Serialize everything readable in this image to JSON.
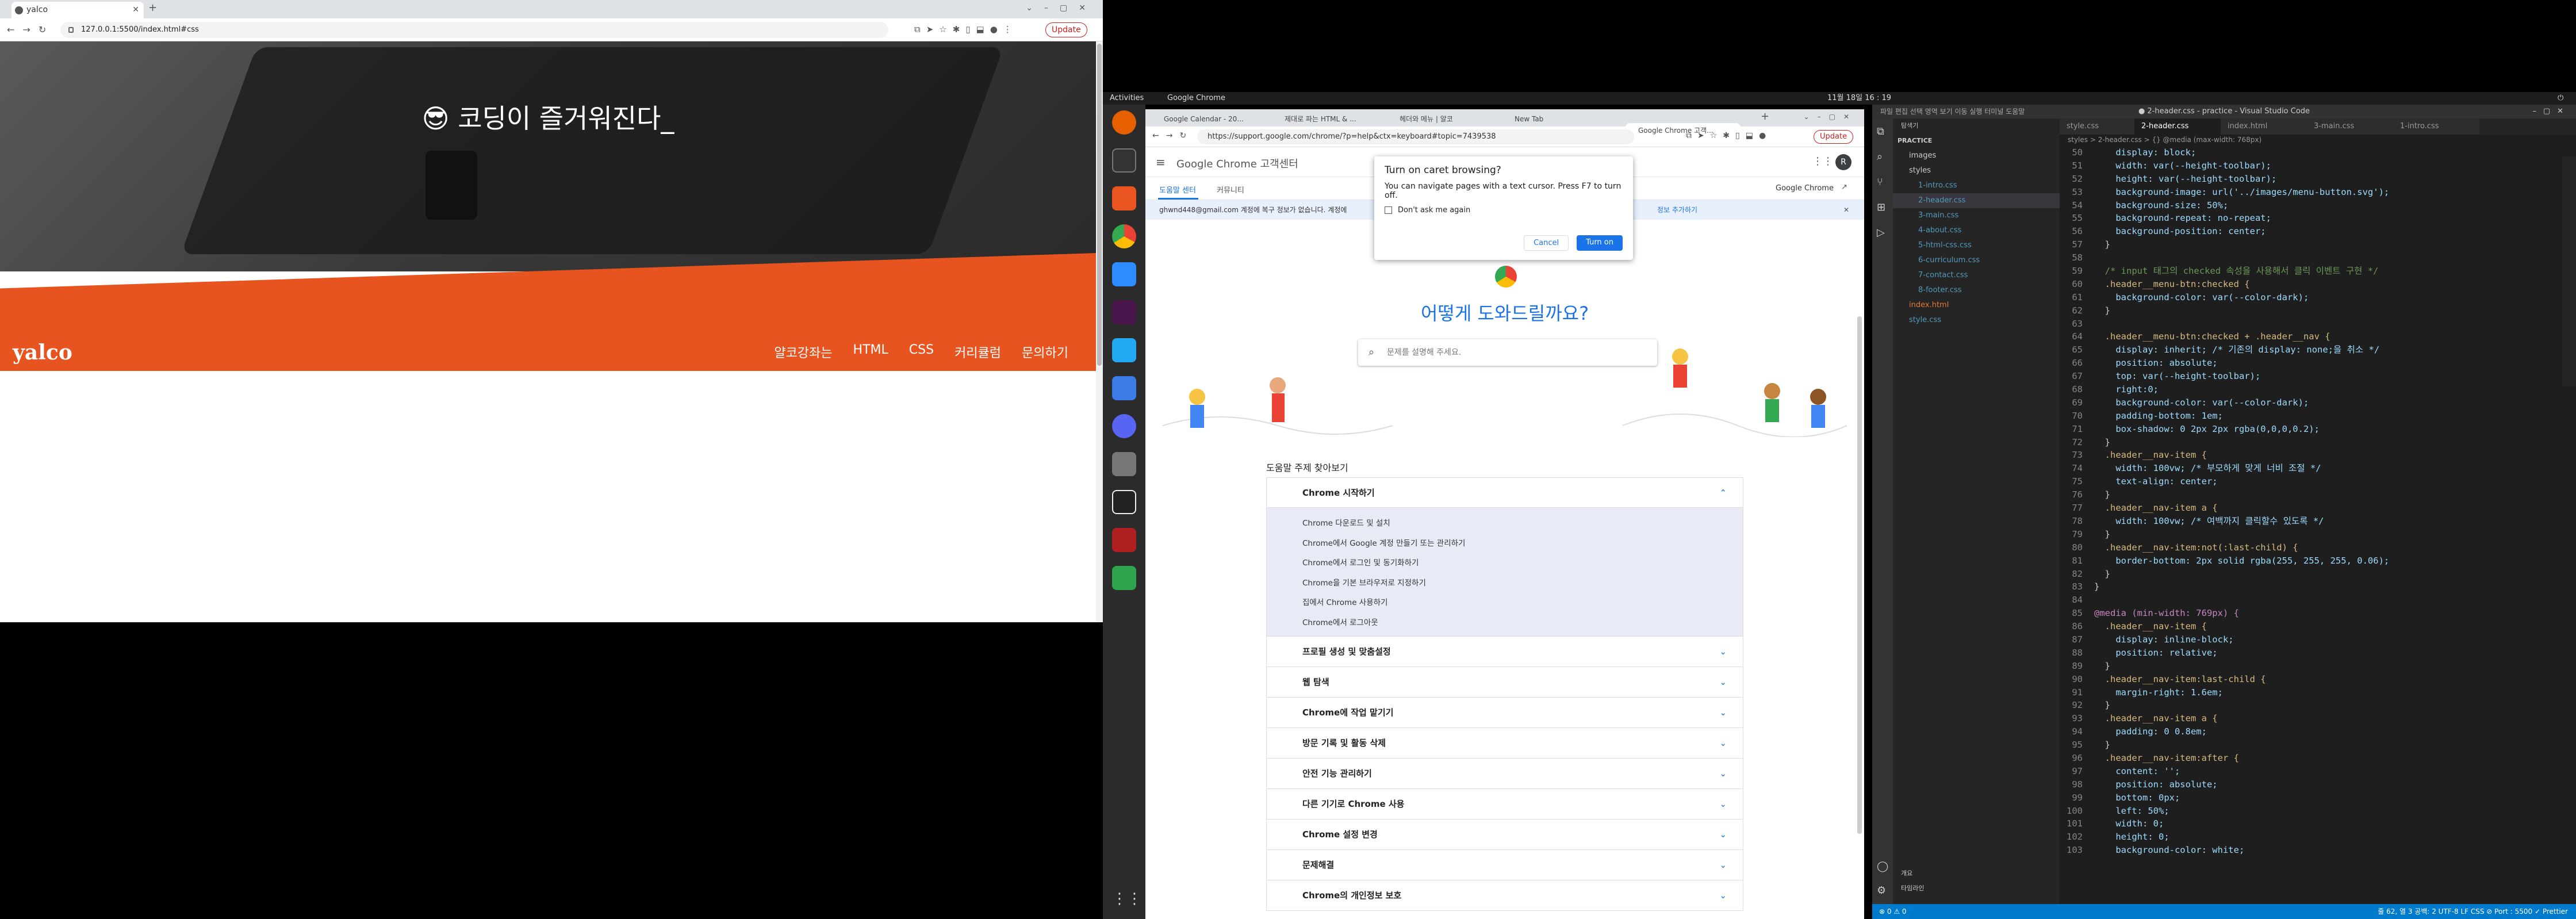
{
  "left_browser": {
    "tab_title": "yalco",
    "url": "127.0.0.1:5500/index.html#css",
    "update_label": "Update",
    "hero_emoji": "😎",
    "hero_text": "코딩이 즐거워진다_",
    "logo": "yalco",
    "menu": [
      "얄코강좌는",
      "HTML",
      "CSS",
      "커리큘럼",
      "문의하기"
    ]
  },
  "system_bar": {
    "activities": "Activities",
    "app": "Google Chrome",
    "clock": "11월 18일 16 : 19",
    "lang": "ko"
  },
  "dock": {
    "icons": [
      "firefox-icon",
      "terminal-icon",
      "software-icon",
      "chrome-icon",
      "zoom-icon",
      "slack-icon",
      "vscode-icon",
      "document-icon",
      "discord-icon",
      "files-icon",
      "music-icon",
      "filezilla-icon",
      "kakao-icon"
    ],
    "apps_label": "apps"
  },
  "chrome": {
    "tabs": [
      "Google Calendar - 20...",
      "제대로 파는 HTML & ...",
      "헤더와 메뉴 | 얄코",
      "New Tab",
      "Google Chrome 고객..."
    ],
    "url": "https://support.google.com/chrome/?p=help&ctx=keyboard#topic=7439538",
    "update_label": "Update",
    "site_title": "Google Chrome 고객센터",
    "nav_tabs": [
      "도움말 센터",
      "커뮤니티"
    ],
    "product_link": "Google Chrome",
    "banner": "ghwnd448@gmail.com 계정에 복구 정보가 없습니다. 계정에",
    "banner_right": "정보 추가하기",
    "heading": "어떻게 도와드릴까요?",
    "search_placeholder": "문제를 설명해 주세요.",
    "topics_title": "도움말 주제 찾아보기",
    "accordion_open": "Chrome 시작하기",
    "accordion_items": [
      "Chrome 다운로드 및 설치",
      "Chrome에서 Google 계정 만들기 또는 관리하기",
      "Chrome에서 로그인 및 동기화하기",
      "Chrome을 기본 브라우저로 지정하기",
      "집에서 Chrome 사용하기",
      "Chrome에서 로그아웃"
    ],
    "accordion_rows": [
      "프로필 생성 및 맞춤설정",
      "웹 탐색",
      "Chrome에 작업 맡기기",
      "방문 기록 및 활동 삭제",
      "안전 기능 관리하기",
      "다른 기기로 Chrome 사용",
      "Chrome 설정 변경",
      "문제해결",
      "Chrome의 개인정보 보호"
    ],
    "popup": {
      "title": "Turn on caret browsing?",
      "body": "You can navigate pages with a text cursor. Press F7 to turn off.",
      "checkbox": "Don't ask me again",
      "cancel": "Cancel",
      "confirm": "Turn on"
    }
  },
  "vscode": {
    "title": "● 2-header.css - practice - Visual Studio Code",
    "menu": "파일  편집  선택 영역  보기  이동  실행  터미널  도움말",
    "explorer_title": "탐색기",
    "folder": "PRACTICE",
    "files": [
      "images",
      "styles",
      "1-intro.css",
      "2-header.css",
      "3-main.css",
      "4-about.css",
      "5-html-css.css",
      "6-curriculum.css",
      "7-contact.css",
      "8-footer.css",
      "index.html",
      "style.css"
    ],
    "outline": "개요",
    "timeline": "타임라인",
    "tabs": [
      "style.css",
      "2-header.css",
      "index.html",
      "3-main.css",
      "1-intro.css"
    ],
    "breadcrumb": "styles > 2-header.css > {} @media (max-width: 768px)",
    "code_lines": [
      {
        "n": "50",
        "t": "    display: block;"
      },
      {
        "n": "51",
        "t": "    width: var(--height-toolbar);"
      },
      {
        "n": "52",
        "t": "    height: var(--height-toolbar);"
      },
      {
        "n": "53",
        "t": "    background-image: url('../images/menu-button.svg');"
      },
      {
        "n": "54",
        "t": "    background-size: 50%;"
      },
      {
        "n": "55",
        "t": "    background-repeat: no-repeat;"
      },
      {
        "n": "56",
        "t": "    background-position: center;"
      },
      {
        "n": "57",
        "t": "  }"
      },
      {
        "n": "58",
        "t": ""
      },
      {
        "n": "59",
        "t": "  /* input 태그의 checked 속성을 사용해서 클릭 이벤트 구현 */"
      },
      {
        "n": "60",
        "t": "  .header__menu-btn:checked {"
      },
      {
        "n": "61",
        "t": "    background-color: var(--color-dark);"
      },
      {
        "n": "62",
        "t": "  }"
      },
      {
        "n": "63",
        "t": ""
      },
      {
        "n": "64",
        "t": "  .header__menu-btn:checked + .header__nav {"
      },
      {
        "n": "65",
        "t": "    display: inherit; /* 기존의 display: none;을 취소 */"
      },
      {
        "n": "66",
        "t": "    position: absolute;"
      },
      {
        "n": "67",
        "t": "    top: var(--height-toolbar);"
      },
      {
        "n": "68",
        "t": "    right:0;"
      },
      {
        "n": "69",
        "t": "    background-color: var(--color-dark);"
      },
      {
        "n": "70",
        "t": "    padding-bottom: 1em;"
      },
      {
        "n": "71",
        "t": "    box-shadow: 0 2px 2px rgba(0,0,0,0.2);"
      },
      {
        "n": "72",
        "t": "  }"
      },
      {
        "n": "73",
        "t": "  .header__nav-item {"
      },
      {
        "n": "74",
        "t": "    width: 100vw; /* 부모하게 맞게 너비 조절 */"
      },
      {
        "n": "75",
        "t": "    text-align: center;"
      },
      {
        "n": "76",
        "t": "  }"
      },
      {
        "n": "77",
        "t": "  .header__nav-item a {"
      },
      {
        "n": "78",
        "t": "    width: 100vw; /* 여백까지 클릭할수 있도록 */"
      },
      {
        "n": "79",
        "t": "  }"
      },
      {
        "n": "80",
        "t": "  .header__nav-item:not(:last-child) {"
      },
      {
        "n": "81",
        "t": "    border-bottom: 2px solid rgba(255, 255, 255, 0.06);"
      },
      {
        "n": "82",
        "t": "  }"
      },
      {
        "n": "83",
        "t": "}"
      },
      {
        "n": "84",
        "t": ""
      },
      {
        "n": "85",
        "t": "@media (min-width: 769px) {"
      },
      {
        "n": "86",
        "t": "  .header__nav-item {"
      },
      {
        "n": "87",
        "t": "    display: inline-block;"
      },
      {
        "n": "88",
        "t": "    position: relative;"
      },
      {
        "n": "89",
        "t": "  }"
      },
      {
        "n": "90",
        "t": "  .header__nav-item:last-child {"
      },
      {
        "n": "91",
        "t": "    margin-right: 1.6em;"
      },
      {
        "n": "92",
        "t": "  }"
      },
      {
        "n": "93",
        "t": "  .header__nav-item a {"
      },
      {
        "n": "94",
        "t": "    padding: 0 0.8em;"
      },
      {
        "n": "95",
        "t": "  }"
      },
      {
        "n": "96",
        "t": "  .header__nav-item:after {"
      },
      {
        "n": "97",
        "t": "    content: '';"
      },
      {
        "n": "98",
        "t": "    position: absolute;"
      },
      {
        "n": "99",
        "t": "    bottom: 0px;"
      },
      {
        "n": "100",
        "t": "    left: 50%;"
      },
      {
        "n": "101",
        "t": "    width: 0;"
      },
      {
        "n": "102",
        "t": "    height: 0;"
      },
      {
        "n": "103",
        "t": "    background-color: white;"
      }
    ],
    "status_left": "⊗ 0 ⚠ 0",
    "status_right": "줄 62, 열 3   공백: 2   UTF-8   LF   CSS   ⊘ Port : 5500   ✓ Prettier"
  }
}
